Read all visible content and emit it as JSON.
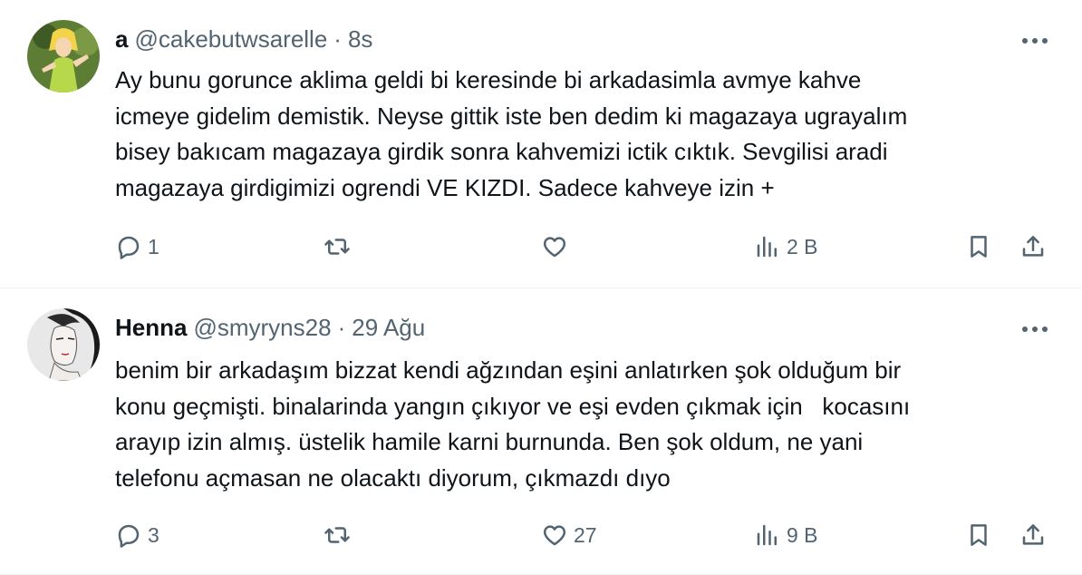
{
  "tweets": [
    {
      "name": "a",
      "handle": "@cakebutwsarelle",
      "separator": "·",
      "time": "8s",
      "lines": [
        "Ay bunu gorunce aklima geldi bi keresinde bi arkadasimla avmye kahve",
        "icmeye gidelim demistik. Neyse gittik iste ben dedim ki magazaya ugrayalım",
        "bisey bakıcam magazaya girdik sonra kahvemizi ictik cıktık. Sevgilisi aradi",
        "magazaya girdigimizi ogrendi VE KIZDI. Sadece kahveye izin +"
      ],
      "replies": "1",
      "retweets": "",
      "likes": "",
      "views": "2 B",
      "avatar_color": "#6f8f3a"
    },
    {
      "name": "Henna",
      "handle": "@smyryns28",
      "separator": "·",
      "time": "29 Ağu",
      "lines": [
        "benim bir arkadaşım bizzat kendi ağzından eşini anlatırken şok olduğum bir",
        "konu geçmişti. binalarinda yangın çıkıyor ve eşi evden çıkmak için   kocasını",
        "arayıp izin almış. üstelik hamile karni burnunda. Ben şok oldum, ne yani",
        "telefonu açmasan ne olacaktı diyorum, çıkmazdı dıyo"
      ],
      "replies": "3",
      "retweets": "",
      "likes": "27",
      "views": "9 B",
      "avatar_color": "#d9d9d9"
    }
  ],
  "icons": {
    "more": "more-horizontal-icon",
    "reply": "reply-icon",
    "retweet": "retweet-icon",
    "like": "heart-icon",
    "views": "views-chart-icon",
    "bookmark": "bookmark-icon",
    "share": "share-icon"
  },
  "colors": {
    "text": "#0f1419",
    "secondary": "#536471",
    "divider": "#eff3f4"
  }
}
